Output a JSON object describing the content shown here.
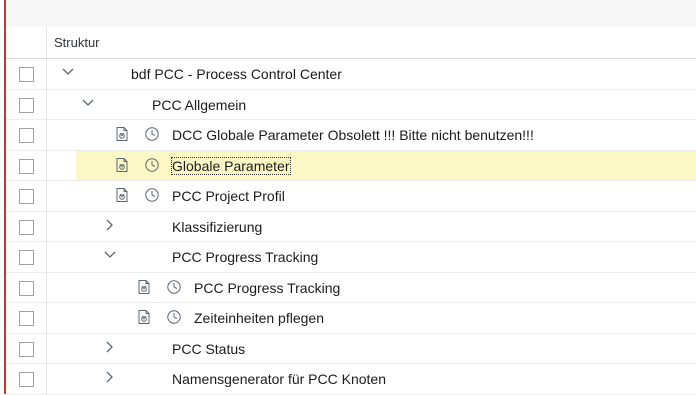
{
  "header": {
    "column_label": "Struktur"
  },
  "rows": [
    {
      "label": "bdf PCC - Process Control Center",
      "expander": "expanded"
    },
    {
      "label": "PCC Allgemein",
      "expander": "expanded"
    },
    {
      "label": "DCC Globale Parameter  Obsolett !!! Bitte nicht benutzen!!!",
      "expander": "none",
      "icons": [
        "doc-icon",
        "clock-icon"
      ]
    },
    {
      "label": "Globale Parameter",
      "expander": "none",
      "icons": [
        "doc-icon",
        "clock-icon"
      ],
      "selected": true
    },
    {
      "label": "PCC Project Profil",
      "expander": "none",
      "icons": [
        "doc-icon",
        "clock-icon"
      ]
    },
    {
      "label": "Klassifizierung",
      "expander": "collapsed"
    },
    {
      "label": "PCC Progress Tracking",
      "expander": "expanded"
    },
    {
      "label": "PCC Progress Tracking",
      "expander": "none",
      "icons": [
        "doc-icon",
        "clock-icon"
      ]
    },
    {
      "label": "Zeiteinheiten pflegen",
      "expander": "none",
      "icons": [
        "doc-icon",
        "clock-icon"
      ]
    },
    {
      "label": "PCC Status",
      "expander": "collapsed"
    },
    {
      "label": "Namensgenerator für PCC Knoten",
      "expander": "collapsed"
    }
  ],
  "colors": {
    "selected_row": "#fcf8c5",
    "frame_accent": "#c0392b"
  }
}
